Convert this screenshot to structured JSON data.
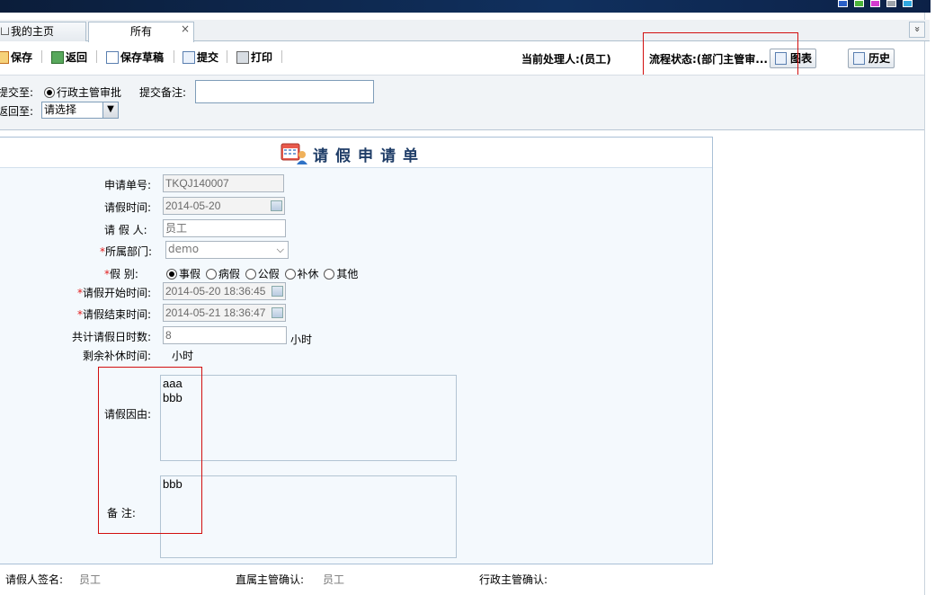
{
  "tabs": {
    "home": "我的主页",
    "all": "所有",
    "close_glyph": "×",
    "collapse_glyph": "»"
  },
  "toolbar": {
    "save": "保存",
    "back": "返回",
    "save_draft": "保存草稿",
    "submit": "提交",
    "print": "打印",
    "current_handler": "当前处理人:(员工)",
    "flow_status": "流程状态:(部门主管审...",
    "chart_btn": "图表",
    "history_btn": "历史"
  },
  "action_panel": {
    "submit_to_label": "提交至:",
    "submit_to_option": "行政主管审批",
    "submit_note_label": "提交备注:",
    "submit_note_value": "",
    "return_to_label": "返回至:",
    "return_to_value": "请选择"
  },
  "form": {
    "title": "请假申请单",
    "fields": {
      "request_no_label": "申请单号:",
      "request_no": "TKQJ140007",
      "leave_time_label": "请假时间:",
      "leave_time": "2014-05-20",
      "applicant_label": "请 假 人:",
      "applicant": "员工",
      "department_label": "所属部门:",
      "department": "demo",
      "leave_type_label": "假    别:",
      "leave_types": [
        "事假",
        "病假",
        "公假",
        "补休",
        "其他"
      ],
      "start_label": "请假开始时间:",
      "start": "2014-05-20 18:36:45",
      "end_label": "请假结束时间:",
      "end": "2014-05-21 18:36:47",
      "total_hours_label": "共计请假日时数:",
      "total_hours": "8",
      "hours_unit": "小时",
      "remaining_label": "剩余补休时间:",
      "remaining_value": "小时",
      "reason_label": "请假因由:",
      "reason_line1": "aaa",
      "reason_line2": "bbb",
      "remark_label": "备    注:",
      "remark": "bbb"
    }
  },
  "signatures": {
    "applicant_label": "请假人签名:",
    "applicant_value": "员工",
    "supervisor_label": "直属主管确认:",
    "supervisor_value": "员工",
    "admin_label": "行政主管确认:",
    "admin_value": ""
  },
  "colors": {
    "highlight_box": "#d20f0f",
    "title": "#1f3d67",
    "required": "#e21b1b"
  }
}
